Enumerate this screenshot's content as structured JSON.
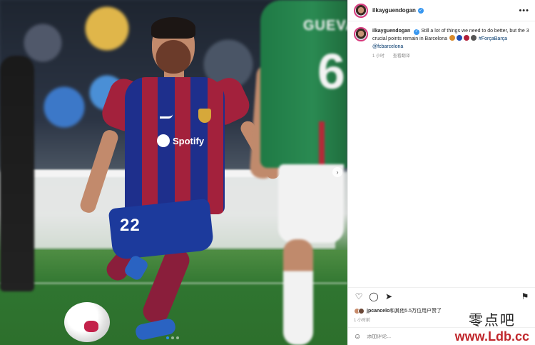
{
  "post": {
    "username": "ilkayguendogan",
    "more_label": "•••",
    "caption": {
      "username": "ilkayguendogan",
      "text": "Still a lot of things we need to do better, but the 3 crucial points remain in Barcelona",
      "hashtag": "#ForçaBarça",
      "mention": "@fcbarcelona",
      "emojis": [
        "#d98b2b",
        "#1f4fb4",
        "#b0203a",
        "#555555"
      ]
    },
    "caption_time": "1 小时",
    "translate_label": "查看翻译",
    "likes": {
      "user": "jpcancelo",
      "rest": "和其他5.5万位用户赞了"
    },
    "post_time": "1 小时前",
    "comment_placeholder": "添加评论..."
  },
  "photo": {
    "sponsor": "Spotify",
    "shorts_number": "22",
    "opponent_name": "GUEVA",
    "opponent_number": "6",
    "carousel_dots": 3
  },
  "watermark": {
    "title": "零点吧",
    "url": "www.Ldb.cc"
  },
  "icons": [
    "heart-icon",
    "comment-icon",
    "share-icon",
    "bookmark-icon",
    "emoji-icon",
    "more-icon",
    "chevron-right-icon"
  ]
}
